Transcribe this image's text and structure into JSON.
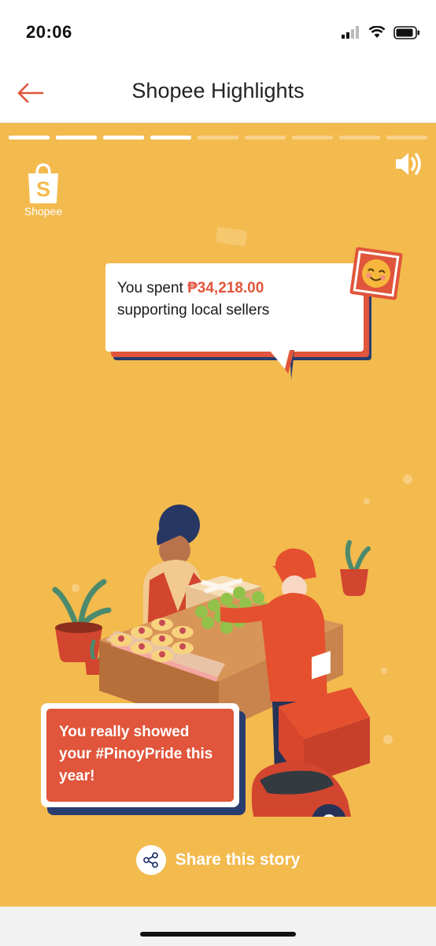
{
  "status": {
    "time": "20:06",
    "icons": [
      "signal-icon",
      "wifi-icon",
      "battery-icon"
    ]
  },
  "header": {
    "title": "Shopee Highlights",
    "back_icon": "back-arrow-icon"
  },
  "story": {
    "progress": {
      "total": 9,
      "completed": 4
    },
    "logo": {
      "label": "Shopee",
      "mark": "S"
    },
    "sound_icon": "speaker-icon",
    "bubble": {
      "prefix": "You spent ",
      "amount": "₱34,218.00",
      "suffix": "supporting local sellers"
    },
    "emoji_icon": "smiling-face-icon",
    "pride_message": "You really showed your #PinoyPride this year!",
    "share": {
      "label": "Share this story",
      "icon": "share-icon"
    }
  },
  "colors": {
    "background": "#F3BA4E",
    "accent": "#E0553B",
    "navy": "#283D6E",
    "header_text": "#222222"
  }
}
